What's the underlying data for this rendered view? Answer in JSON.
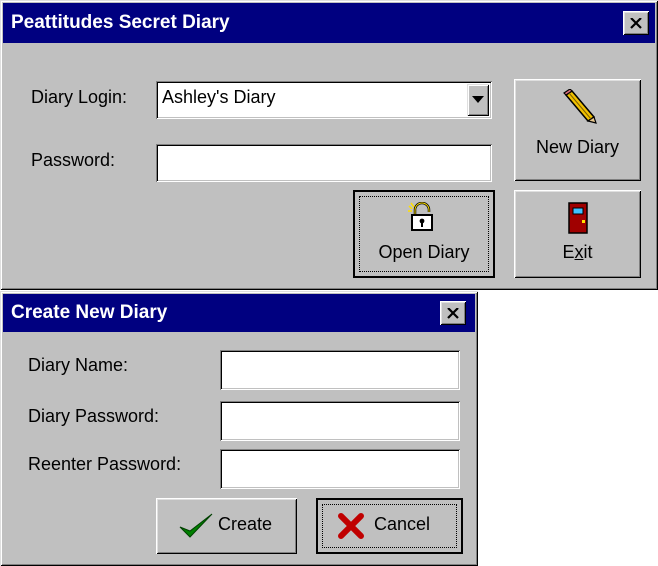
{
  "login_window": {
    "title": "Peattitudes Secret Diary",
    "diary_login_label": "Diary Login:",
    "diary_login_value": "Ashley's Diary",
    "password_label": "Password:",
    "password_value": "",
    "new_diary_button": "New Diary",
    "open_diary_button": "Open Diary",
    "exit_button_pre": "E",
    "exit_button_underlined": "x",
    "exit_button_post": "it"
  },
  "create_window": {
    "title": "Create New Diary",
    "diary_name_label": "Diary Name:",
    "diary_password_label": "Diary Password:",
    "reenter_password_label": "Reenter Password:",
    "create_button": "Create",
    "cancel_button": "Cancel"
  },
  "icons": {
    "close": "close-x-icon",
    "dropdown": "chevron-down-icon",
    "new_diary": "pencil-icon",
    "open_diary": "padlock-icon",
    "exit": "door-icon",
    "create": "checkmark-icon",
    "cancel": "x-mark-icon"
  },
  "colors": {
    "titlebar": "#000080",
    "face": "#c0c0c0",
    "checkmark": "#008000",
    "cancel_x": "#c00000",
    "door": "#a00000"
  }
}
